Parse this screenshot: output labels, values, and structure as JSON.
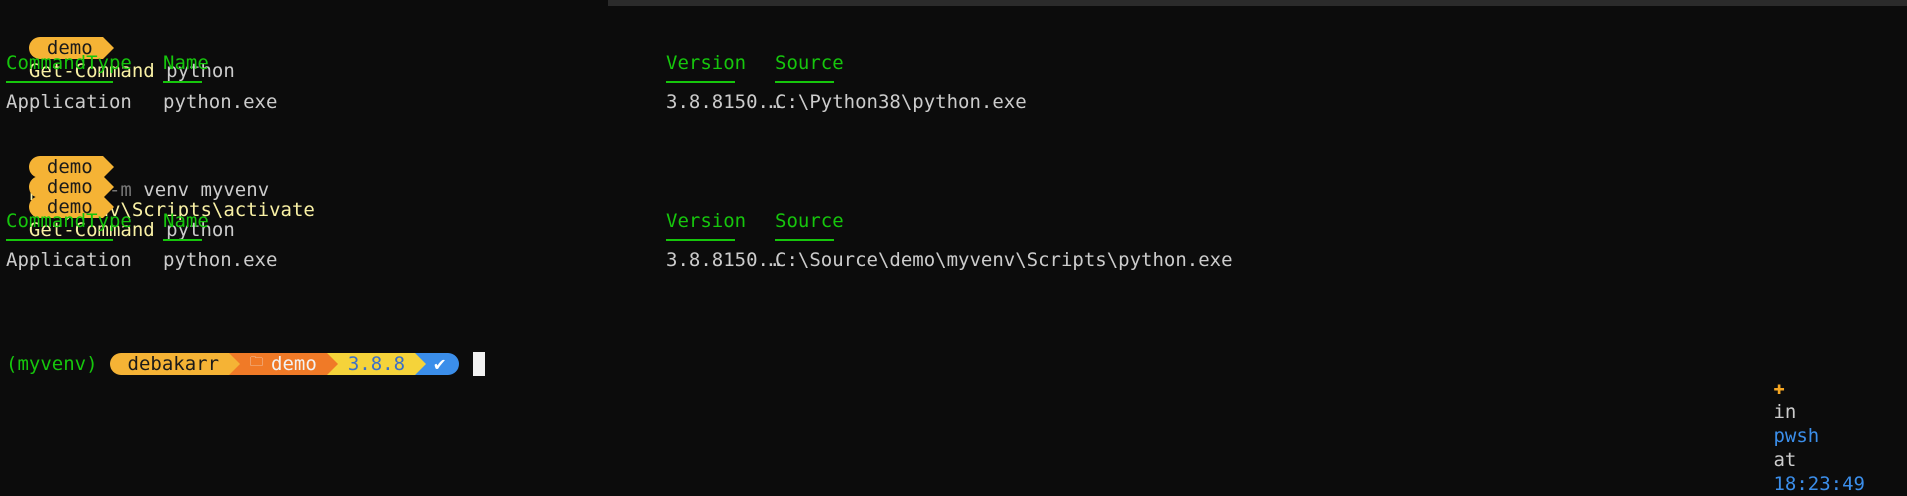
{
  "prompt_label": "demo",
  "commands": [
    {
      "cmd": "Get-Command",
      "rest": " python"
    },
    {
      "cmd": "python",
      "param": " -m",
      "rest": " venv myvenv"
    },
    {
      "cmd": ".\\myvenv\\Scripts\\activate",
      "rest": ""
    },
    {
      "cmd": "Get-Command",
      "rest": " python"
    }
  ],
  "table_headers": {
    "type": "CommandType",
    "name": "Name",
    "version": "Version",
    "source": "Source"
  },
  "results": [
    {
      "type": "Application",
      "name": "python.exe",
      "version": "3.8.8150.…",
      "source": "C:\\Python38\\python.exe"
    },
    {
      "type": "Application",
      "name": "python.exe",
      "version": "3.8.8150.…",
      "source": "C:\\Source\\demo\\myvenv\\Scripts\\python.exe"
    }
  ],
  "final_prompt": {
    "venv": "(myvenv)",
    "user": "debakarr",
    "folder_icon": "folder-icon",
    "dir": "demo",
    "py_version": "3.8.8",
    "status_icon": "check-icon"
  },
  "right_status": {
    "icon": "gear-icon",
    "in": "in",
    "shell": "pwsh",
    "at": "at",
    "time": "18:23:49"
  }
}
